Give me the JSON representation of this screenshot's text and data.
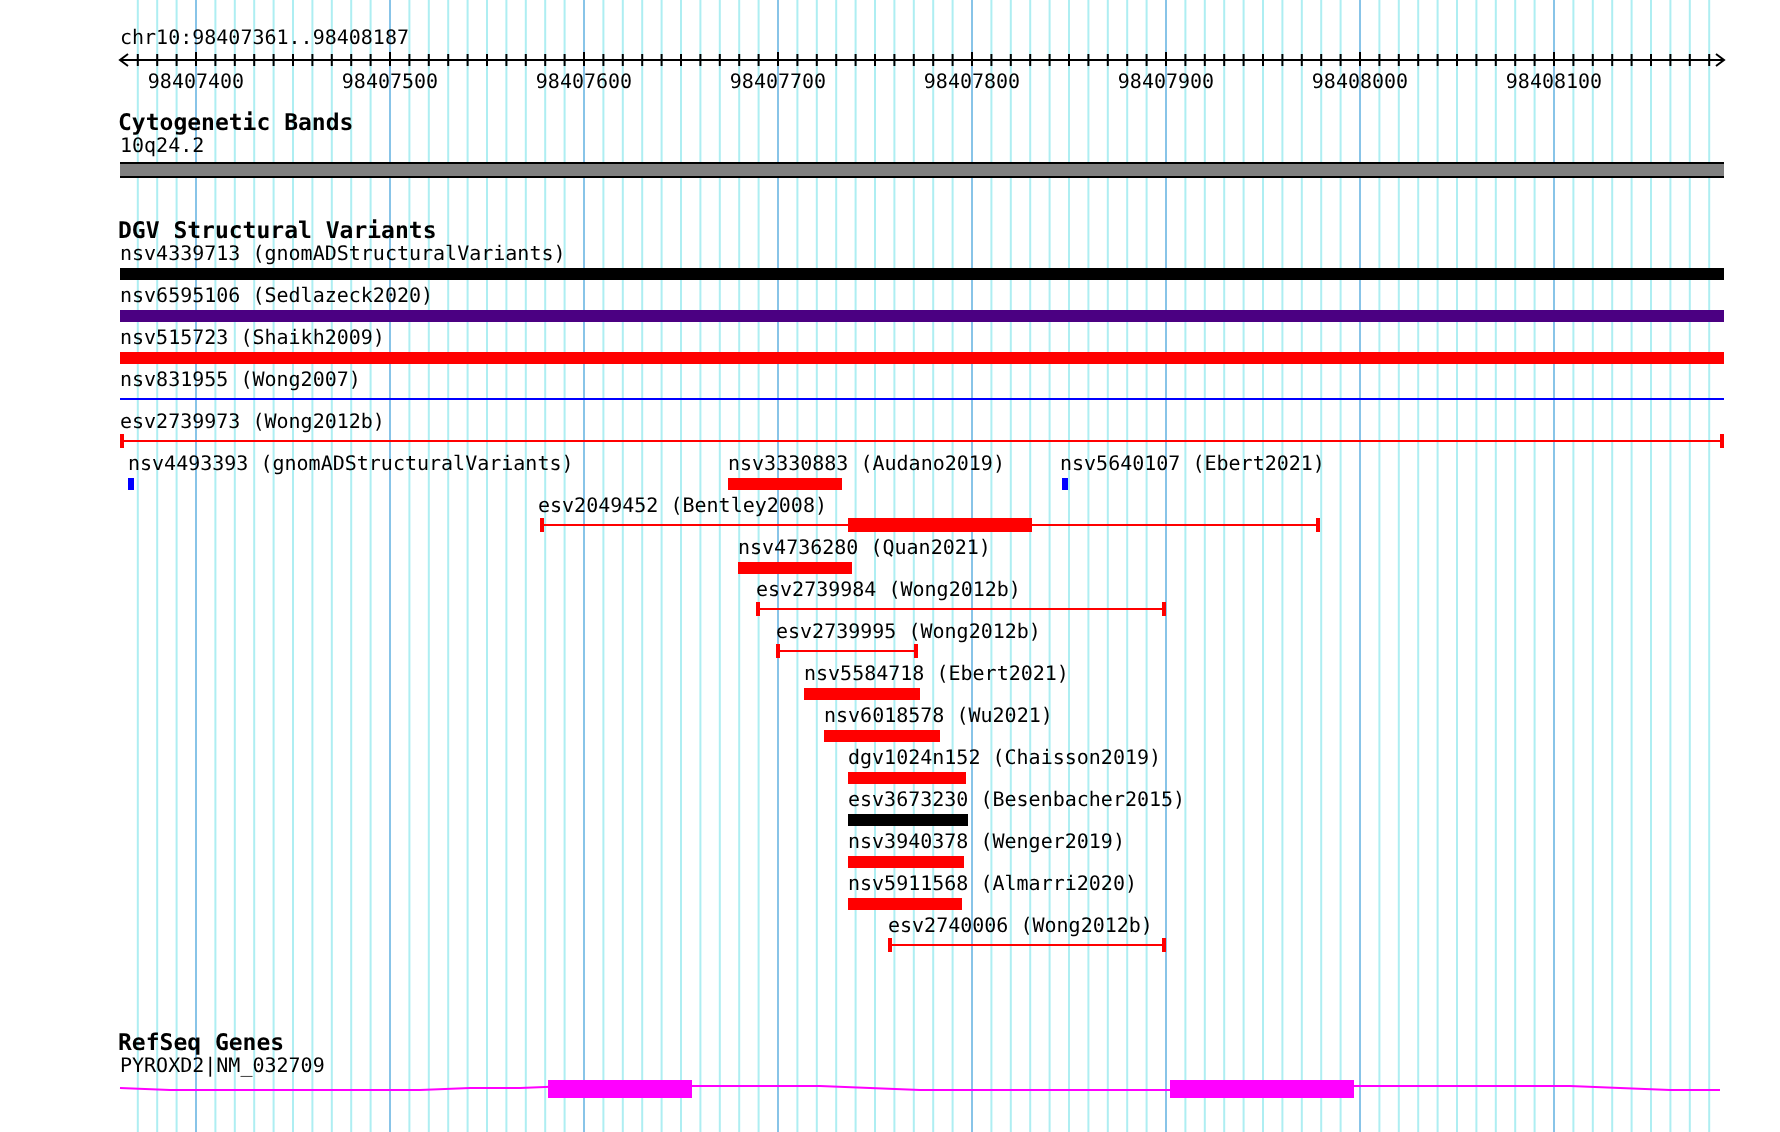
{
  "ruler": {
    "location": "chr10:98407361..98408187",
    "ticks": [
      "98407400",
      "98407500",
      "98407600",
      "98407700",
      "98407800",
      "98407900",
      "98408000",
      "98408100"
    ]
  },
  "tracks": [
    {
      "kind": "cytobands",
      "title": "Cytogenetic Bands",
      "features": [
        {
          "label": "10q24.2"
        }
      ]
    },
    {
      "kind": "variants",
      "title": "DGV Structural Variants",
      "features": [
        {
          "label": "nsv4339713 (gnomADStructuralVariants)",
          "kind": "bar",
          "color": "#000000"
        },
        {
          "label": "nsv6595106 (Sedlazeck2020)",
          "kind": "bar",
          "color": "#4b0082"
        },
        {
          "label": "nsv515723 (Shaikh2009)",
          "kind": "bar",
          "color": "#ff0000"
        },
        {
          "label": "nsv831955 (Wong2007)",
          "kind": "thin",
          "color": "#0000ff"
        },
        {
          "label": "esv2739973 (Wong2012b)",
          "kind": "capped",
          "color": "#ff0000"
        },
        {
          "label": "nsv4493393 (gnomADStructuralVariants)",
          "kind": "bar",
          "color": "#0000ff"
        },
        {
          "label": "nsv3330883 (Audano2019)",
          "kind": "bar",
          "color": "#ff0000"
        },
        {
          "label": "nsv5640107 (Ebert2021)",
          "kind": "bar",
          "color": "#0000ff"
        },
        {
          "label": "esv2049452 (Bentley2008)",
          "kind": "segmented",
          "color": "#ff0000"
        },
        {
          "label": "nsv4736280 (Quan2021)",
          "kind": "bar",
          "color": "#ff0000"
        },
        {
          "label": "esv2739984 (Wong2012b)",
          "kind": "capped",
          "color": "#ff0000"
        },
        {
          "label": "esv2739995 (Wong2012b)",
          "kind": "capped",
          "color": "#ff0000"
        },
        {
          "label": "nsv5584718 (Ebert2021)",
          "kind": "bar",
          "color": "#ff0000"
        },
        {
          "label": "nsv6018578 (Wu2021)",
          "kind": "bar",
          "color": "#ff0000"
        },
        {
          "label": "dgv1024n152 (Chaisson2019)",
          "kind": "bar",
          "color": "#ff0000"
        },
        {
          "label": "esv3673230 (Besenbacher2015)",
          "kind": "bar",
          "color": "#000000"
        },
        {
          "label": "nsv3940378 (Wenger2019)",
          "kind": "bar",
          "color": "#ff0000"
        },
        {
          "label": "nsv5911568 (Almarri2020)",
          "kind": "bar",
          "color": "#ff0000"
        },
        {
          "label": "esv2740006 (Wong2012b)",
          "kind": "capped",
          "color": "#ff0000"
        }
      ]
    },
    {
      "kind": "genes",
      "title": "RefSeq Genes",
      "features": [
        {
          "label": "PYROXD2|NM_032709"
        }
      ]
    }
  ]
}
